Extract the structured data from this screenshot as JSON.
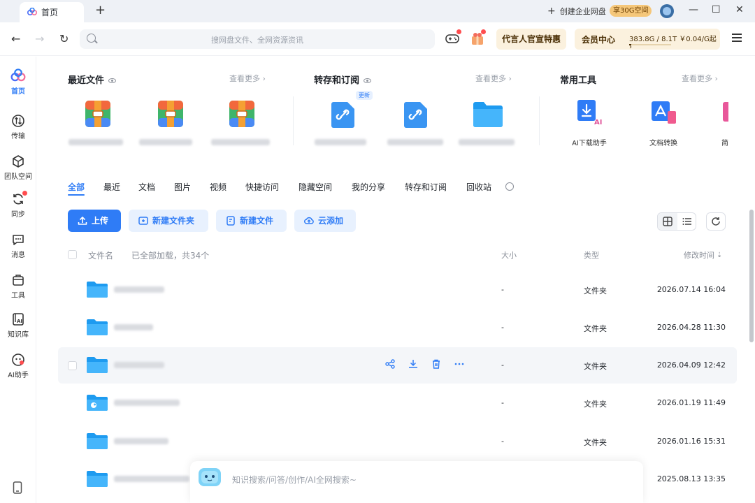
{
  "titlebar": {
    "tab_label": "首页",
    "new_tab": "+",
    "enterprise_label": "创建企业网盘",
    "enterprise_promo": "享30G空间",
    "minimize": "—",
    "maximize": "☐",
    "close": "✕"
  },
  "navbar": {
    "back": "←",
    "forward": "→",
    "refresh": "↻",
    "search_placeholder": "搜网盘文件、全网资源资讯",
    "promo_label": "代言人官宣特惠",
    "member_label": "会员中心",
    "quota_text": "383.8G / 8.1T",
    "quota_price": "￥0.04/G起 ›",
    "quota_used_fraction": 0.046
  },
  "sidebar": {
    "items": [
      {
        "label": "首页",
        "icon": "home-logo-icon"
      },
      {
        "label": "传输",
        "icon": "transfer-icon"
      },
      {
        "label": "团队空间",
        "icon": "team-space-icon"
      },
      {
        "label": "同步",
        "icon": "sync-icon"
      },
      {
        "label": "消息",
        "icon": "message-icon"
      },
      {
        "label": "工具",
        "icon": "tools-icon"
      },
      {
        "label": "知识库",
        "icon": "knowledge-base-icon"
      },
      {
        "label": "AI助手",
        "icon": "ai-assistant-icon"
      }
    ]
  },
  "quick": {
    "recent_title": "最近文件",
    "transfer_title": "转存和订阅",
    "tools_title": "常用工具",
    "see_more": "查看更多 ›",
    "new_badge": "更新",
    "tools": [
      "AI下载助手",
      "文档转换",
      "简"
    ]
  },
  "filetabs": [
    "全部",
    "最近",
    "文档",
    "图片",
    "视频",
    "快捷访问",
    "隐藏空间",
    "我的分享",
    "转存和订阅",
    "回收站"
  ],
  "actions": {
    "upload": "上传",
    "new_folder": "新建文件夹",
    "new_file": "新建文件",
    "cloud_add": "云添加"
  },
  "table": {
    "col_name": "文件名",
    "loaded_text": "已全部加载，共34个",
    "col_size": "大小",
    "col_type": "类型",
    "col_modified": "修改时间",
    "sort_arrow": "⇣",
    "rows": [
      {
        "size": "-",
        "type": "文件夹",
        "modified": "2026.07.14 16:04"
      },
      {
        "size": "-",
        "type": "文件夹",
        "modified": "2026.04.28 11:30"
      },
      {
        "size": "-",
        "type": "文件夹",
        "modified": "2026.04.09 12:42"
      },
      {
        "size": "-",
        "type": "文件夹",
        "modified": "2026.01.19 11:49"
      },
      {
        "size": "-",
        "type": "文件夹",
        "modified": "2026.01.16 15:31"
      },
      {
        "size": "",
        "type": "",
        "modified": "2025.08.13 13:35"
      }
    ]
  },
  "aibar": {
    "placeholder": "知识搜索/问答/创作/AI全网搜索~"
  },
  "colors": {
    "accent": "#2f7cf6",
    "folder": "#2aa7f5",
    "promo_bg": "#fbf1de"
  }
}
